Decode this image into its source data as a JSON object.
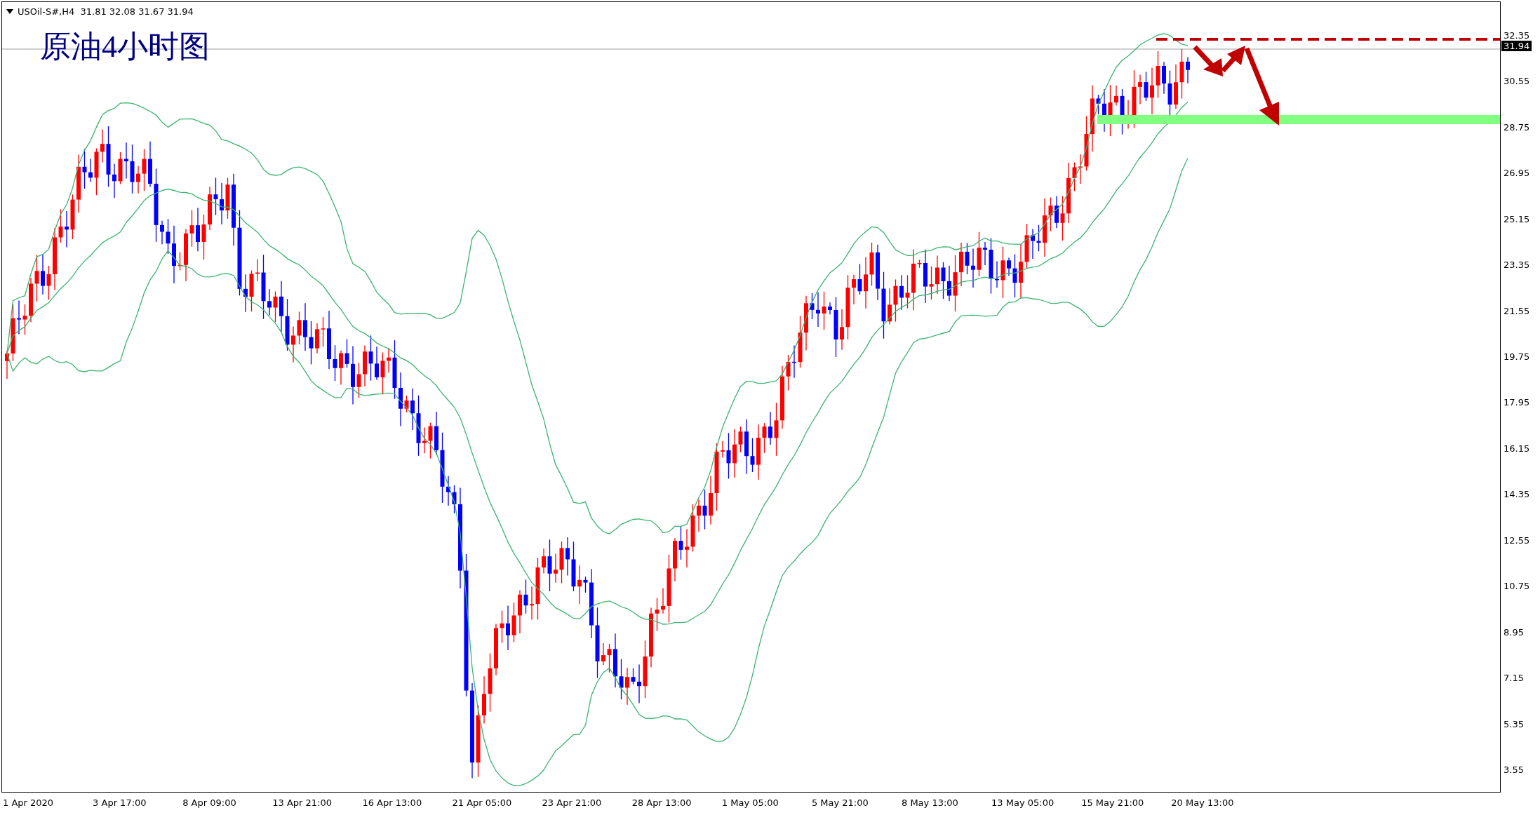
{
  "chart": {
    "symbol_info": "USOil-S#,H4  31.81 32.08 31.67 31.94",
    "title": "原油4小时图",
    "current_price": "31.94",
    "price_ticks": [
      "32.35",
      "30.55",
      "28.75",
      "26.95",
      "25.15",
      "23.35",
      "21.55",
      "19.75",
      "17.95",
      "16.15",
      "14.35",
      "12.55",
      "10.75",
      "8.95",
      "7.15",
      "5.35",
      "3.55"
    ],
    "time_labels": [
      "1 Apr 2020",
      "3 Apr 17:00",
      "8 Apr 09:00",
      "13 Apr 21:00",
      "16 Apr 13:00",
      "21 Apr 05:00",
      "23 Apr 21:00",
      "28 Apr 13:00",
      "1 May 05:00",
      "5 May 21:00",
      "8 May 13:00",
      "13 May 05:00",
      "15 May 21:00",
      "20 May 13:00"
    ]
  }
}
